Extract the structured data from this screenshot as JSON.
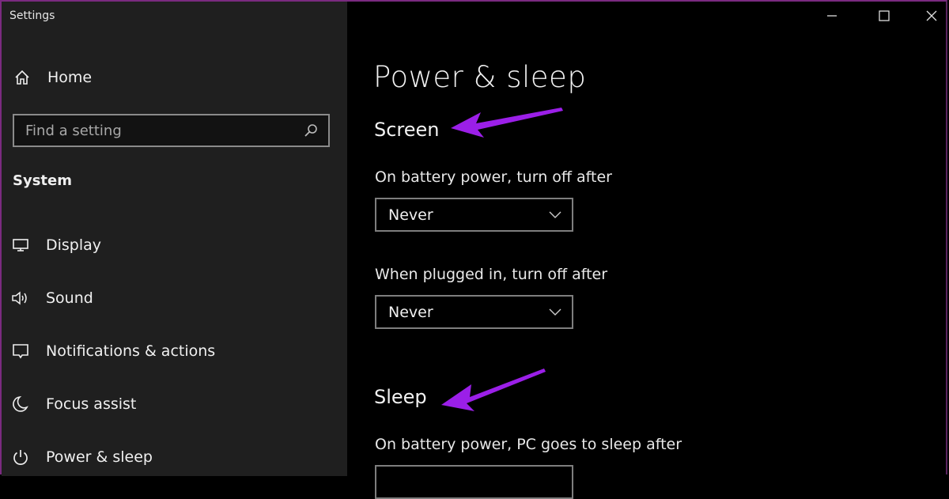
{
  "window": {
    "title": "Settings",
    "controls": {
      "minimize": "minimize-icon",
      "maximize": "maximize-icon",
      "close": "close-icon"
    }
  },
  "sidebar": {
    "home_label": "Home",
    "search": {
      "placeholder": "Find a setting",
      "value": ""
    },
    "section_label": "System",
    "items": [
      {
        "label": "Display",
        "icon": "monitor-icon"
      },
      {
        "label": "Sound",
        "icon": "speaker-icon"
      },
      {
        "label": "Notifications & actions",
        "icon": "notification-icon"
      },
      {
        "label": "Focus assist",
        "icon": "moon-icon"
      },
      {
        "label": "Power & sleep",
        "icon": "power-icon"
      }
    ]
  },
  "main": {
    "page_title": "Power & sleep",
    "screen": {
      "title": "Screen",
      "battery_label": "On battery power, turn off after",
      "battery_value": "Never",
      "plugged_label": "When plugged in, turn off after",
      "plugged_value": "Never"
    },
    "sleep": {
      "title": "Sleep",
      "battery_label": "On battery power, PC goes to sleep after",
      "battery_value": ""
    }
  },
  "annotations": {
    "arrow_color": "#9b1fe8"
  }
}
